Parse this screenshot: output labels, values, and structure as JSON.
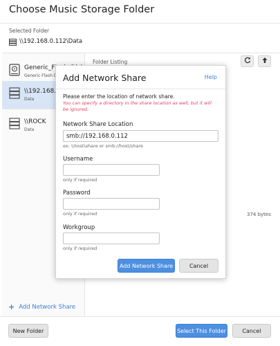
{
  "window": {
    "title": "Choose Music Storage Folder",
    "selected_label": "Selected Folder",
    "selected_path": "\\\\192.168.0.112\\Data"
  },
  "sidebar": {
    "devices": [
      {
        "name": "Generic_Flash_Disk",
        "sub": "Generic Flash Disk",
        "icon": "hard-drive-icon"
      },
      {
        "name": "\\\\192.168.0.112",
        "sub": "Data",
        "icon": "network-server-icon",
        "active": true
      },
      {
        "name": "\\\\ROCK",
        "sub": "Data",
        "icon": "network-server-icon"
      }
    ],
    "add_share_label": "Add Network Share"
  },
  "content": {
    "listing_label": "Folder Listing",
    "file_size": "374 bytes",
    "refresh_icon": "refresh-icon",
    "up_icon": "arrow-up-icon"
  },
  "footer": {
    "new_folder": "New Folder",
    "select_folder": "Select This Folder",
    "cancel": "Cancel"
  },
  "dialog": {
    "title": "Add Network Share",
    "help": "Help",
    "intro": "Please enter the location of network share.",
    "note": "You can specify a directory in the share location as well, but it will be ignored.",
    "location_label": "Network Share Location",
    "location_value": "smb://192.168.0.112",
    "location_hint": "ex: \\\\host\\share or smb://host/share",
    "username_label": "Username",
    "username_hint": "only if required",
    "password_label": "Password",
    "password_hint": "only if required",
    "workgroup_label": "Workgroup",
    "workgroup_hint": "only if required",
    "add_button": "Add Network Share",
    "cancel_button": "Cancel"
  },
  "colors": {
    "accent": "#4d8fe0",
    "link": "#3a7fd4",
    "warning_text": "#e0405c",
    "selected_row": "#d7e5f6"
  }
}
